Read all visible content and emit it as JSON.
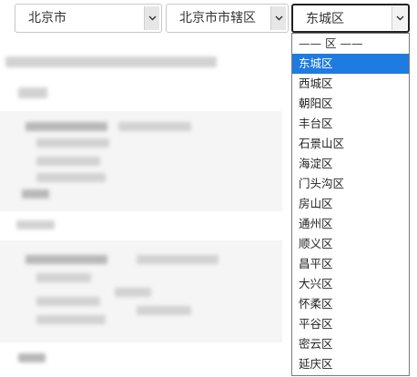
{
  "selects": {
    "province": {
      "value": "北京市"
    },
    "city": {
      "value": "北京市市辖区"
    },
    "district": {
      "value": "东城区"
    }
  },
  "dropdown": {
    "selected_index": 1,
    "options": [
      "—— 区 ——",
      "东城区",
      "西城区",
      "朝阳区",
      "丰台区",
      "石景山区",
      "海淀区",
      "门头沟区",
      "房山区",
      "通州区",
      "顺义区",
      "昌平区",
      "大兴区",
      "怀柔区",
      "平谷区",
      "密云区",
      "延庆区"
    ]
  },
  "colors": {
    "selected_bg": "#1e7be0",
    "background_blur": "#d2d2d2"
  }
}
